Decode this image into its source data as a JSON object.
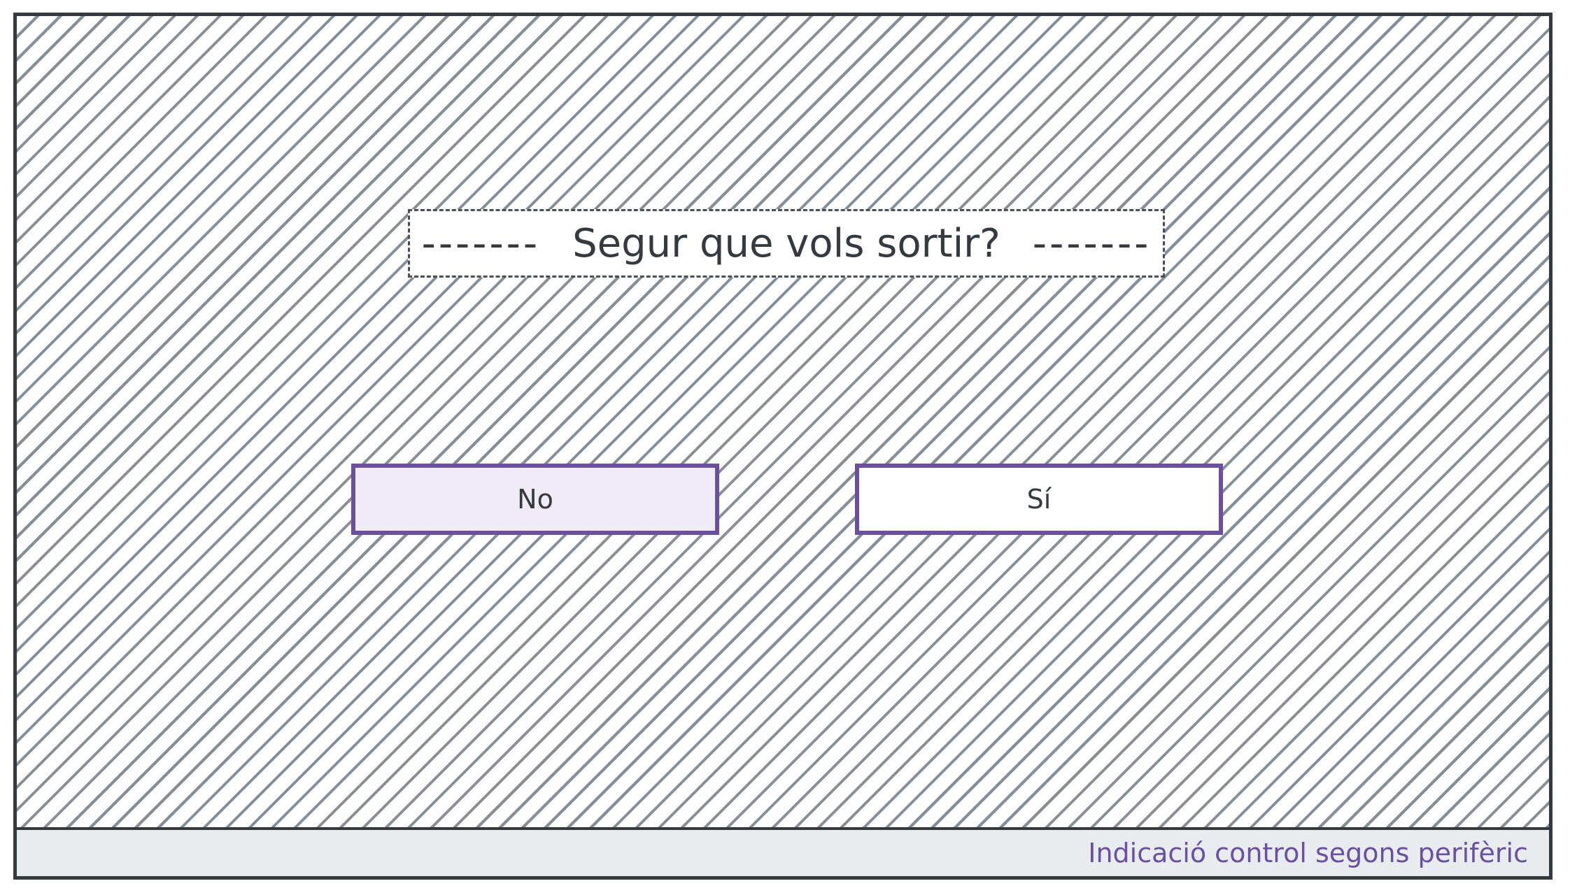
{
  "dialog": {
    "left_dashes": "-------",
    "title": "Segur que vols sortir?",
    "right_dashes": "-------"
  },
  "buttons": {
    "no_label": "No",
    "yes_label": "Sí"
  },
  "footer": {
    "hint": "Indicació control segons perifèric"
  },
  "colors": {
    "accent": "#6a4fa3",
    "frame": "#343a40",
    "hatch": "#868e96",
    "selected_button_bg": "#efebf7",
    "footer_bg": "#e9ecef"
  }
}
